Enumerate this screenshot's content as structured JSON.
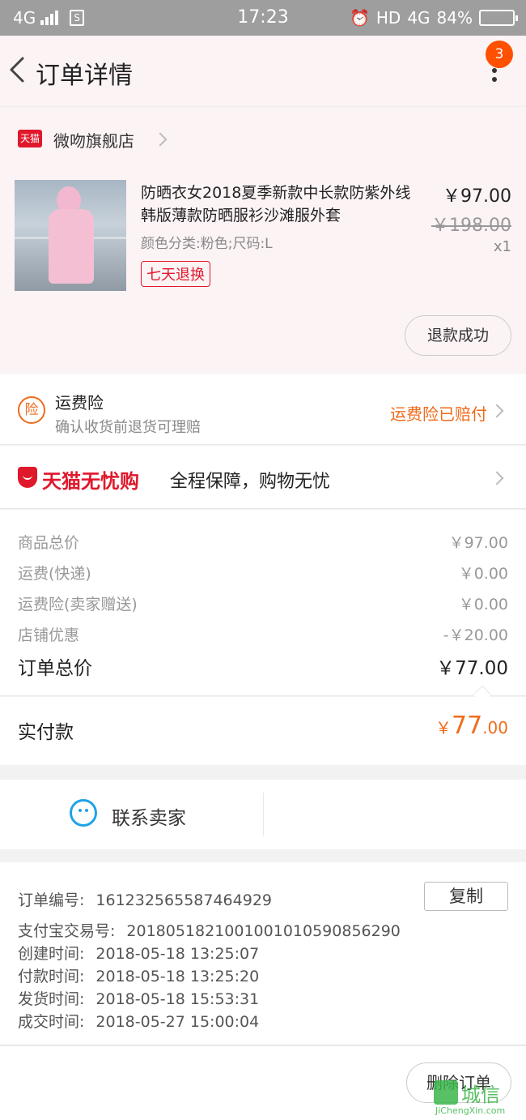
{
  "status_bar": {
    "network": "4G",
    "time": "17:23",
    "hd_label": "HD",
    "network_right": "4G",
    "battery_pct": "84%",
    "battery_level": 0.84
  },
  "header": {
    "title": "订单详情",
    "badge_count": "3"
  },
  "shop": {
    "tag": "天猫",
    "name": "微吻旗舰店"
  },
  "product": {
    "title": "防晒衣女2018夏季新款中长款防紫外线韩版薄款防晒服衫沙滩服外套",
    "sku": "颜色分类:粉色;尺码:L",
    "return_tag": "七天退换",
    "price_now": "￥97.00",
    "price_old": "￥198.00",
    "quantity": "x1",
    "refund_button": "退款成功"
  },
  "insurance": {
    "icon_text": "险",
    "title": "运费险",
    "subtitle": "确认收货前退货可理赔",
    "status": "运费险已赔付"
  },
  "guarantee": {
    "brand": "天猫无忧购",
    "text": "全程保障，购物无忧"
  },
  "summary": {
    "rows": [
      {
        "label": "商品总价",
        "value": "￥97.00"
      },
      {
        "label": "运费(快递)",
        "value": "￥0.00"
      },
      {
        "label": "运费险(卖家赠送)",
        "value": "￥0.00"
      },
      {
        "label": "店铺优惠",
        "value": "-￥20.00"
      }
    ],
    "total_label": "订单总价",
    "total_value": "￥77.00"
  },
  "paid": {
    "label": "实付款",
    "currency": "￥",
    "integer": "77",
    "decimal": ".00"
  },
  "contact": {
    "label": "联系卖家"
  },
  "order_info": {
    "copy_button": "复制",
    "rows": [
      {
        "label": "订单编号:",
        "value": "161232565587464929"
      },
      {
        "label": "支付宝交易号:",
        "value": "2018051821001001010590856290"
      },
      {
        "label": "创建时间:",
        "value": "2018-05-18 13:25:07"
      },
      {
        "label": "付款时间:",
        "value": "2018-05-18 13:25:20"
      },
      {
        "label": "发货时间:",
        "value": "2018-05-18 15:53:31"
      },
      {
        "label": "成交时间:",
        "value": "2018-05-27 15:00:04"
      }
    ]
  },
  "footer": {
    "delete_button": "删除订单"
  },
  "watermark": {
    "text": "城信",
    "url": "JiChengXin.com"
  },
  "colors": {
    "accent_orange": "#f06b1b",
    "tmall_red": "#e0182c",
    "contact_blue": "#1fa3e8"
  }
}
